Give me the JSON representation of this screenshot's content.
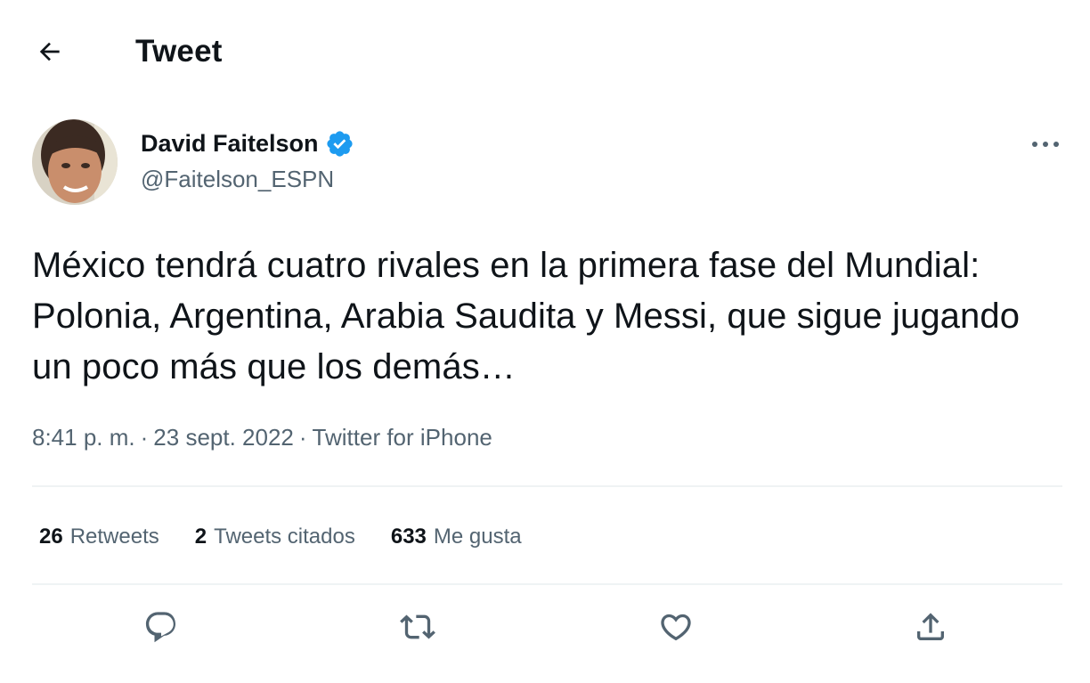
{
  "header": {
    "title": "Tweet",
    "back_icon": "arrow-left-icon"
  },
  "tweet": {
    "author": {
      "name": "David Faitelson",
      "handle": "@Faitelson_ESPN",
      "verified": true,
      "verified_color": "#1d9bf0"
    },
    "text": "México tendrá cuatro rivales en la primera fase del Mundial: Polonia, Argentina, Arabia Saudita y Messi, que sigue jugando un poco más que los demás…",
    "time": "8:41 p. m.",
    "date": "23 sept. 2022",
    "separator": "·",
    "source": "Twitter for iPhone"
  },
  "stats": {
    "retweets_count": "26",
    "retweets_label": "Retweets",
    "quotes_count": "2",
    "quotes_label": "Tweets citados",
    "likes_count": "633",
    "likes_label": "Me gusta"
  },
  "actions": {
    "reply_icon": "reply-icon",
    "retweet_icon": "retweet-icon",
    "like_icon": "heart-icon",
    "share_icon": "share-icon"
  },
  "colors": {
    "text_primary": "#0f1419",
    "text_secondary": "#536471",
    "divider": "#eff3f4",
    "accent": "#1d9bf0"
  }
}
